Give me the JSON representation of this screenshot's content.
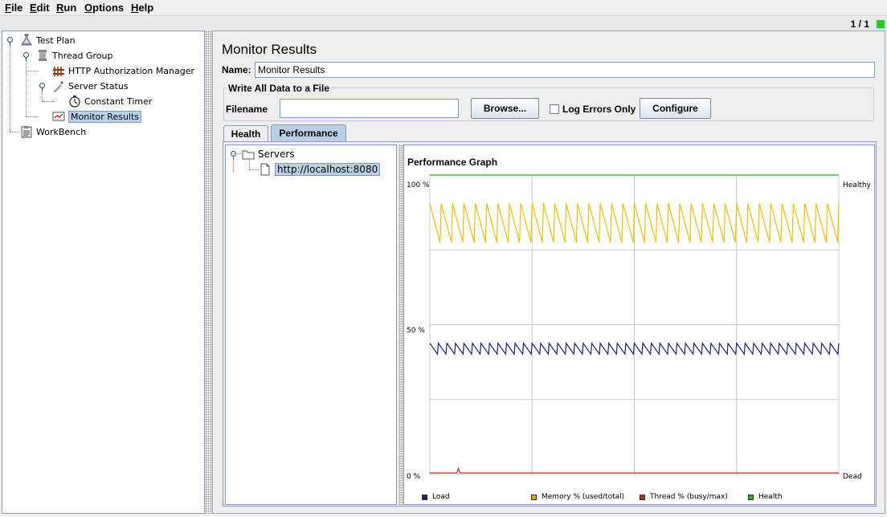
{
  "menu": {
    "items": [
      {
        "label": "File",
        "mnemonic": "F",
        "rest": "ile"
      },
      {
        "label": "Edit",
        "mnemonic": "E",
        "rest": "dit"
      },
      {
        "label": "Run",
        "mnemonic": "R",
        "rest": "un"
      },
      {
        "label": "Options",
        "mnemonic": "O",
        "rest": "ptions"
      },
      {
        "label": "Help",
        "mnemonic": "H",
        "rest": "elp"
      }
    ]
  },
  "status": {
    "counter": "1 / 1",
    "indicator_color": "#22cc22"
  },
  "tree": {
    "test_plan": "Test Plan",
    "thread_group": "Thread Group",
    "http_auth": "HTTP Authorization Manager",
    "server_status": "Server Status",
    "constant_timer": "Constant Timer",
    "monitor_results": "Monitor Results",
    "workbench": "WorkBench"
  },
  "panel": {
    "title": "Monitor Results",
    "name_label": "Name:",
    "name_value": "Monitor Results",
    "file_section_title": "Write All Data to a File",
    "filename_label": "Filename",
    "filename_value": "",
    "browse_label": "Browse...",
    "log_errors_label": "Log Errors Only",
    "log_errors_checked": false,
    "configure_label": "Configure"
  },
  "tabs": {
    "health": "Health",
    "performance": "Performance",
    "active": "Performance"
  },
  "servers": {
    "root": "Servers",
    "host": "http://localhost:8080"
  },
  "chart_data": {
    "type": "line",
    "title": "Performance Graph",
    "y_axis_left": {
      "top": "100 %",
      "middle": "50 %",
      "bottom": "0 %"
    },
    "y_axis_right": {
      "top": "Healthy",
      "bottom": "Dead"
    },
    "ylim": [
      0,
      100
    ],
    "grid": true,
    "legend_position": "bottom",
    "series": [
      {
        "name": "Load",
        "color": "#1a237e",
        "baseline": 42,
        "amplitude": 1.8,
        "cycles": 48
      },
      {
        "name": "Memory % (used/total)",
        "color": "#f0c000",
        "baseline": 84,
        "amplitude": 6.5,
        "cycles": 36
      },
      {
        "name": "Thread % (busy/max)",
        "color": "#c62828",
        "baseline": 0.5,
        "spike_at": 0.07,
        "spike_value": 2
      },
      {
        "name": "Health",
        "color": "#22b522",
        "baseline": 100
      }
    ]
  }
}
